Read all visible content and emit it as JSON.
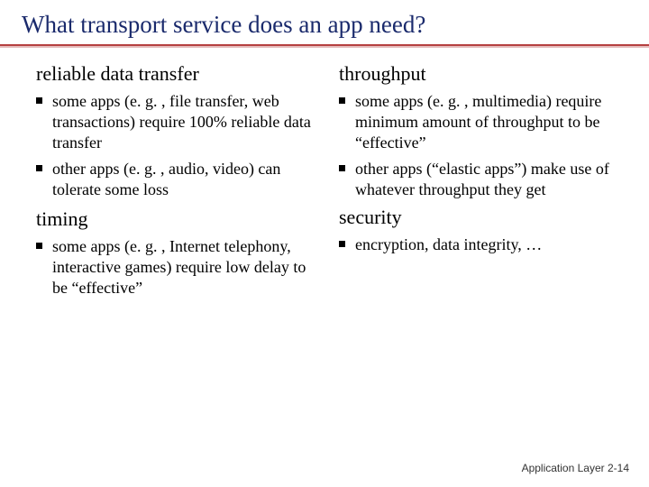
{
  "title": "What transport service does an app need?",
  "left": {
    "h1": "reliable data transfer",
    "b1": "some apps (e. g. , file transfer, web transactions) require 100% reliable data transfer",
    "b2": "other apps (e. g. , audio, video) can tolerate some loss",
    "h2": "timing",
    "b3": "some apps (e. g. , Internet telephony, interactive games) require low delay to be “effective”"
  },
  "right": {
    "h1": "throughput",
    "b1": "some apps (e. g. , multimedia) require minimum amount of throughput to be “effective”",
    "b2": "other apps (“elastic apps”) make use of whatever throughput they get",
    "h2": "security",
    "b3": "encryption, data integrity, …"
  },
  "footer": {
    "label": "Application Layer",
    "page": "2-14"
  }
}
